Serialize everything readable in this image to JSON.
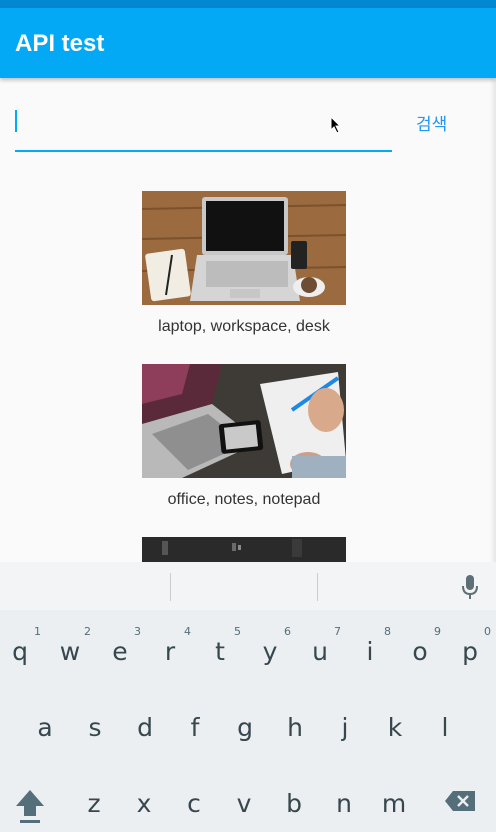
{
  "app_bar": {
    "title": "API test"
  },
  "search": {
    "value": "",
    "placeholder": "",
    "button_label": "검색"
  },
  "results": [
    {
      "tags": "laptop, workspace, desk"
    },
    {
      "tags": "office, notes, notepad"
    },
    {
      "tags": ""
    }
  ],
  "keyboard": {
    "row1": [
      "q",
      "w",
      "e",
      "r",
      "t",
      "y",
      "u",
      "i",
      "o",
      "p"
    ],
    "row1_hints": [
      "1",
      "2",
      "3",
      "4",
      "5",
      "6",
      "7",
      "8",
      "9",
      "0"
    ],
    "row2": [
      "a",
      "s",
      "d",
      "f",
      "g",
      "h",
      "j",
      "k",
      "l"
    ],
    "row3": [
      "z",
      "x",
      "c",
      "v",
      "b",
      "n",
      "m"
    ],
    "icons": {
      "shift": "shift-icon",
      "backspace": "backspace-icon",
      "voice": "mic-icon"
    }
  },
  "colors": {
    "app_bar": "#03a9f4",
    "status_bar": "#0288d1",
    "accent": "#03a9f4",
    "button_text": "#2196f3",
    "keyboard_bg": "#eceff1"
  }
}
